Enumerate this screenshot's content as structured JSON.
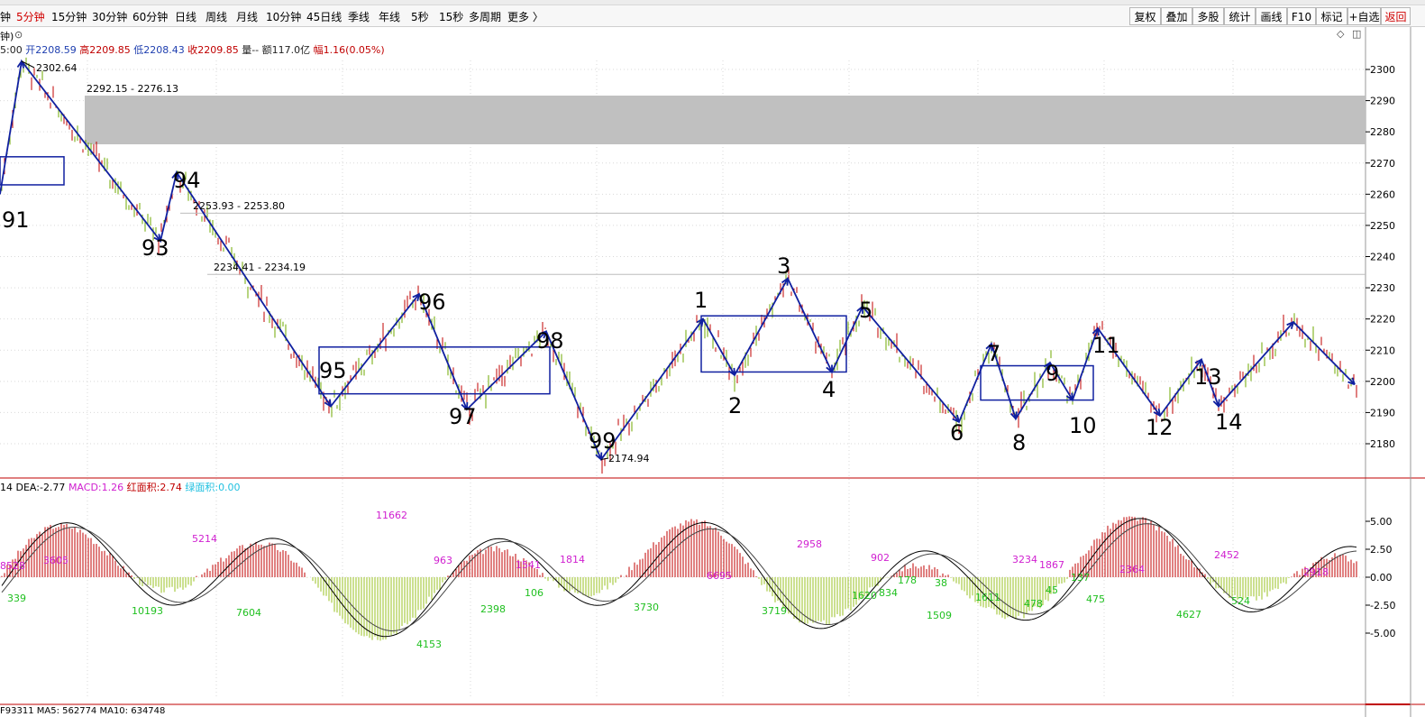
{
  "toolbar": {
    "periods": [
      "钟",
      "5分钟",
      "15分钟",
      "30分钟",
      "60分钟",
      "日线",
      "周线",
      "月线",
      "10分钟",
      "45日线",
      "季线",
      "年线",
      "5秒",
      "15秒",
      "多周期",
      "更多 〉"
    ],
    "active_period": "5分钟",
    "tools": [
      "复权",
      "叠加",
      "多股",
      "统计",
      "画线",
      "F10",
      "标记",
      "+自选",
      "返回"
    ]
  },
  "info": {
    "period_short": "钟)",
    "time": "5:00",
    "open_label": "开",
    "open": "2208.59",
    "high_label": "高",
    "high": "2209.85",
    "low_label": "低",
    "low": "2208.43",
    "close_label": "收",
    "close": "2209.85",
    "vol_label": "量",
    "vol": "--",
    "amount_label": "额",
    "amount": "117.0亿",
    "change_label": "幅",
    "change": "1.16(0.05%)"
  },
  "price_axis": {
    "min": 2170,
    "max": 2305,
    "ticks": [
      2300,
      2290,
      2280,
      2270,
      2260,
      2250,
      2240,
      2230,
      2220,
      2210,
      2200,
      2190,
      2180
    ]
  },
  "annotations": {
    "high_marker": "2302.64",
    "low_marker": "2174.94",
    "zone_label": "2292.15 - 2276.13",
    "line1_label": "2253.93 - 2253.80",
    "line2_label": "2234.41 - 2234.19"
  },
  "wave_labels": [
    "91",
    "93",
    "94",
    "95",
    "96",
    "97",
    "98",
    "99",
    "1",
    "2",
    "3",
    "4",
    "5",
    "6",
    "7",
    "8",
    "9",
    "10",
    "11",
    "12",
    "13",
    "14"
  ],
  "macd": {
    "dif_short": "14",
    "dea_label": "DEA:",
    "dea": "-2.77",
    "macd_label": "MACD:",
    "macd": "1.26",
    "red_area_label": "红面积:",
    "red_area": "2.74",
    "green_area_label": "绿面积:",
    "green_area": "0.00",
    "axis_ticks": [
      "5.00",
      "2.50",
      "0.00",
      "-2.50",
      "-5.00"
    ],
    "area_labels_red": [
      "3605",
      "5214",
      "11662",
      "963",
      "1541",
      "1814",
      "2958",
      "902",
      "3234",
      "1867",
      "2364",
      "2452",
      "2918"
    ],
    "area_labels_green": [
      "339",
      "10193",
      "7604",
      "4153",
      "2398",
      "106",
      "3730",
      "3719",
      "1620",
      "1509",
      "1611",
      "478",
      "45",
      "475",
      "4627",
      "524"
    ],
    "area_label_edge": "8528",
    "area_label_small": [
      "6695",
      "834",
      "178",
      "38",
      "137"
    ]
  },
  "vol_row": "F93311  MA5: 562774  MA10: 634748",
  "colors": {
    "up": "#c00000",
    "down": "#6fa800",
    "wave": "#1020a0",
    "zone": "#c0c0c0",
    "macd_red": "#c00000",
    "macd_green": "#99c020",
    "label_magenta": "#d020d0",
    "label_green": "#20c020"
  }
}
